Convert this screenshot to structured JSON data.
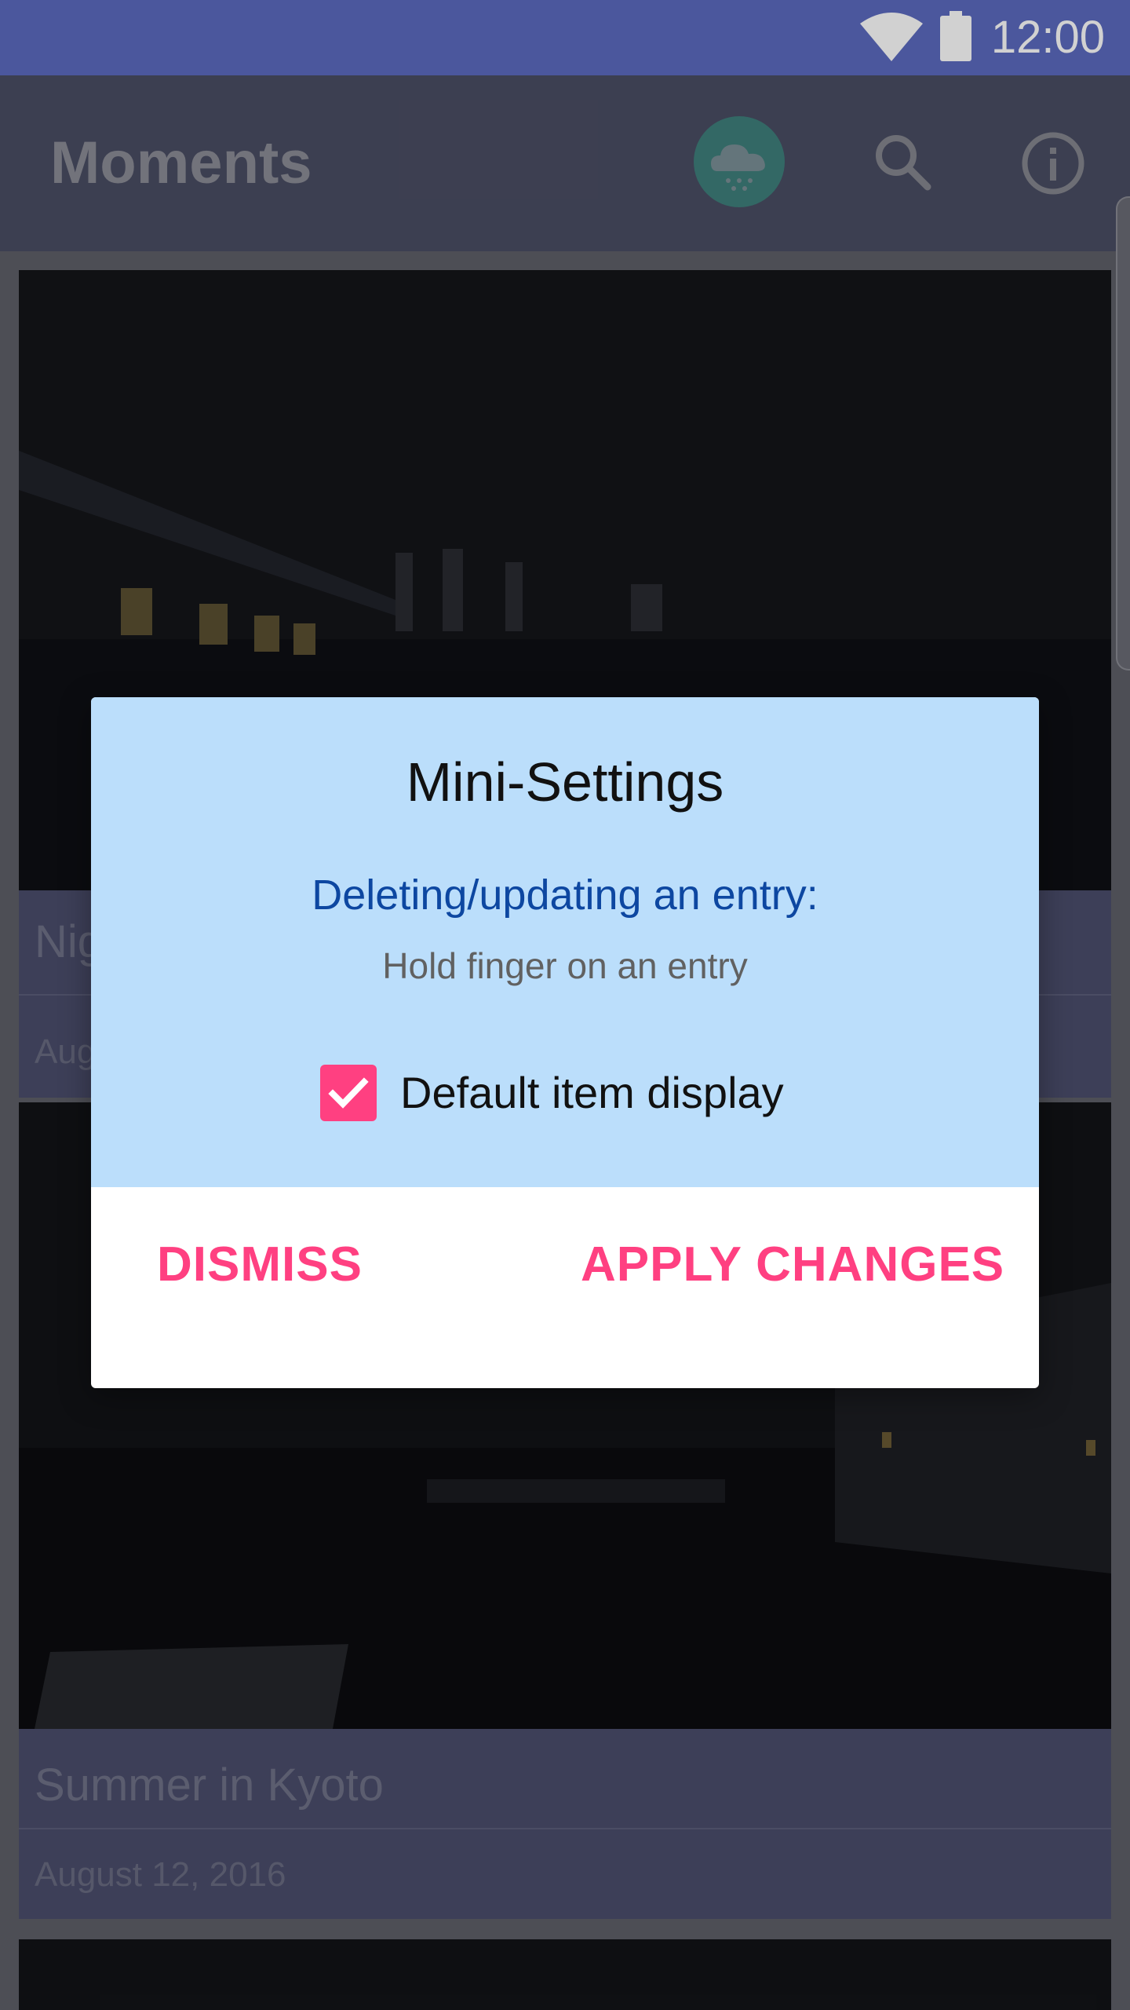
{
  "status_bar": {
    "time": "12:00",
    "wifi_icon": "wifi-icon",
    "battery_icon": "battery-icon"
  },
  "app_bar": {
    "title": "Moments",
    "actions": [
      "weather-cloud-icon",
      "search-icon",
      "info-icon"
    ]
  },
  "feed": {
    "cards": [
      {
        "title": "Nig",
        "date": "Aug"
      },
      {
        "title": "Summer in Kyoto",
        "date": "August 12, 2016"
      }
    ]
  },
  "dialog": {
    "title": "Mini-Settings",
    "subtitle": "Deleting/updating an entry:",
    "hint": "Hold finger on an entry",
    "checkbox": {
      "label": "Default item display",
      "checked": true
    },
    "buttons": {
      "dismiss": "DISMISS",
      "apply": "APPLY CHANGES"
    }
  },
  "colors": {
    "status_bar": "#5c6bc0",
    "dialog_header": "#bbdefb",
    "accent": "#ff4081",
    "subtitle": "#0d47a1"
  }
}
